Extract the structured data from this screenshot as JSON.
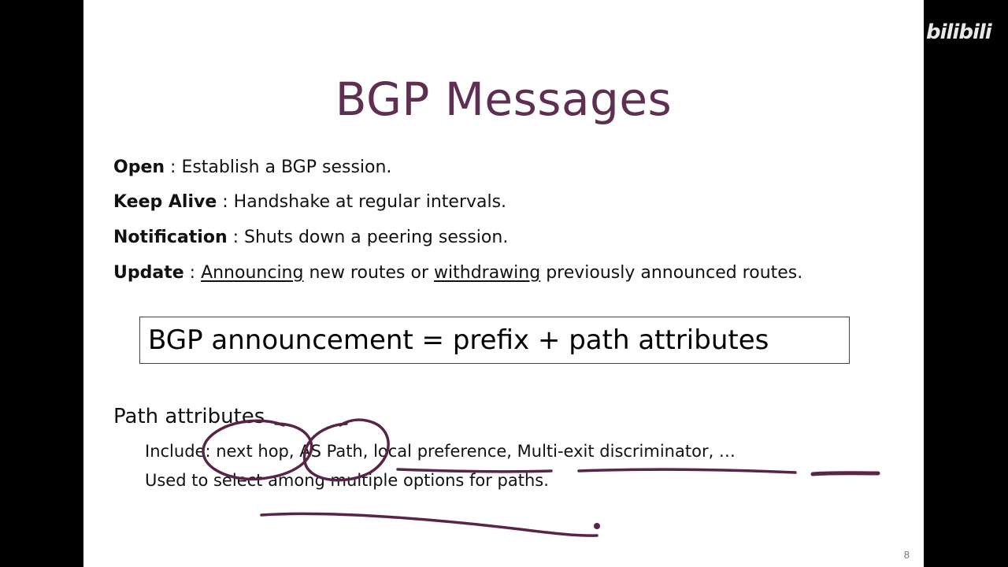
{
  "slide": {
    "title": "BGP Messages",
    "messages": [
      {
        "term": "Open",
        "desc": " : Establish a BGP session."
      },
      {
        "term": "Keep Alive",
        "desc": " : Handshake at regular intervals."
      },
      {
        "term": "Notification",
        "desc": " : Shuts down a peering session."
      }
    ],
    "update": {
      "term": "Update",
      "sep": " : ",
      "word1": "Announcing",
      "mid": " new routes or ",
      "word2": "withdrawing",
      "tail": " previously announced routes."
    },
    "formula": "BGP announcement = prefix + path attributes",
    "path_heading": "Path attributes",
    "path_lines": [
      "Include: next hop, AS Path, local preference, Multi-exit discriminator, …",
      "Used to select among multiple options for paths."
    ],
    "page_number": "8"
  },
  "watermark": "bilibili",
  "colors": {
    "title": "#5e2f50",
    "ink": "#5a2448",
    "frame": "#000000"
  }
}
